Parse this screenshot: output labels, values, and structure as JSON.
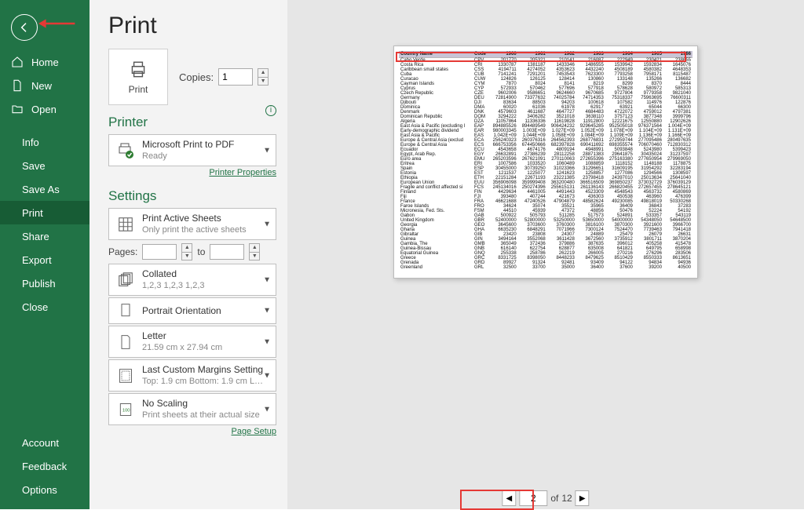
{
  "nav": {
    "home": "Home",
    "new": "New",
    "open": "Open",
    "info": "Info",
    "save": "Save",
    "save_as": "Save As",
    "print": "Print",
    "share": "Share",
    "export": "Export",
    "publish": "Publish",
    "close": "Close",
    "account": "Account",
    "feedback": "Feedback",
    "options": "Options"
  },
  "title": "Print",
  "print_button": "Print",
  "copies_label": "Copies:",
  "copies_value": "1",
  "printer_heading": "Printer",
  "printer": {
    "name": "Microsoft Print to PDF",
    "status": "Ready"
  },
  "printer_properties": "Printer Properties",
  "settings_heading": "Settings",
  "active_sheets": {
    "title": "Print Active Sheets",
    "sub": "Only print the active sheets"
  },
  "pages": {
    "label": "Pages:",
    "to": "to"
  },
  "collated": {
    "title": "Collated",
    "sub": "1,2,3    1,2,3    1,2,3"
  },
  "orientation": "Portrait Orientation",
  "paper": {
    "title": "Letter",
    "sub": "21.59 cm x 27.94 cm"
  },
  "margins": {
    "title": "Last Custom Margins Setting",
    "sub": "Top: 1.9 cm Bottom: 1.9 cm L…"
  },
  "scaling": {
    "title": "No Scaling",
    "sub": "Print sheets at their actual size"
  },
  "page_setup": "Page Setup",
  "pager": {
    "current": "2",
    "of_label": "of",
    "total": "12"
  },
  "preview": {
    "headers": [
      "Country Name",
      "Code",
      "1960",
      "1961",
      "1962",
      "1963",
      "1964",
      "1965",
      "1966"
    ],
    "rows": [
      [
        "Cabo Verde",
        "CPV",
        "201770",
        "205321",
        "210141",
        "216087",
        "222949",
        "230421",
        "238655"
      ],
      [
        "Costa Rica",
        "CRI",
        "1330787",
        "1381187",
        "1433346",
        "1486555",
        "1539942",
        "1592834",
        "1645076"
      ],
      [
        "Caribbean small states",
        "CSS",
        "4194711",
        "4274052",
        "4353623",
        "4432240",
        "4508189",
        "4580382",
        "4648353"
      ],
      [
        "Cuba",
        "CUB",
        "7141241",
        "7291201",
        "7453543",
        "7623300",
        "7793258",
        "7958171",
        "8115487"
      ],
      [
        "Curacao",
        "CUW",
        "124826",
        "126125",
        "128414",
        "130860",
        "133148",
        "135266",
        "136682"
      ],
      [
        "Cayman Islands",
        "CYM",
        "7870",
        "8024",
        "8141",
        "8219",
        "8299",
        "8370",
        "8444"
      ],
      [
        "Cyprus",
        "CYP",
        "572933",
        "570462",
        "577696",
        "577918",
        "578628",
        "580972",
        "585313"
      ],
      [
        "Czech Republic",
        "CZE",
        "9602006",
        "9586651",
        "9624660",
        "9670685",
        "9727804",
        "9779358",
        "9821040"
      ],
      [
        "Germany",
        "DEU",
        "72814900",
        "73377632",
        "74025784",
        "74714353",
        "75318337",
        "75963695",
        "76600311"
      ],
      [
        "Djibouti",
        "DJI",
        "83634",
        "88503",
        "94203",
        "100618",
        "107582",
        "114976",
        "122876"
      ],
      [
        "Dominica",
        "DMA",
        "60020",
        "61036",
        "61978",
        "62917",
        "63921",
        "65044",
        "66300"
      ],
      [
        "Denmark",
        "DNK",
        "4579603",
        "4611687",
        "4647727",
        "4684483",
        "4722072",
        "4759012",
        "4797381"
      ],
      [
        "Dominican Republic",
        "DOM",
        "3294222",
        "3406282",
        "3521018",
        "3638110",
        "3757123",
        "3877348",
        "3999796"
      ],
      [
        "Algeria",
        "DZA",
        "11057864",
        "11336336",
        "11619828",
        "11912800",
        "12221675",
        "12550880",
        "12902626"
      ],
      [
        "East Asia & Pacific (excluding I",
        "EAP",
        "894885526",
        "894489549",
        "906424232",
        "929645285",
        "952505018",
        "976371564",
        "1.004E+09"
      ],
      [
        "Early-demographic dividend",
        "EAR",
        "980003345",
        "1.003E+09",
        "1.027E+09",
        "1.052E+09",
        "1.078E+09",
        "1.104E+09",
        "1.131E+09"
      ],
      [
        "East Asia & Pacific",
        "EAS",
        "1.042E+09",
        "1.044E+09",
        "1.058E+09",
        "1.084E+09",
        "1.109E+09",
        "1.136E+09",
        "1.166E+09"
      ],
      [
        "Europe & Central Asia (exclud",
        "ECA",
        "256240323",
        "260376316",
        "264562393",
        "268776831",
        "272959744",
        "277095486",
        "280497635"
      ],
      [
        "Europe & Central Asia",
        "ECS",
        "666753356",
        "674450666",
        "682397828",
        "690411692",
        "698355574",
        "706070460",
        "712830312"
      ],
      [
        "Ecuador",
        "ECU",
        "4543658",
        "4674176",
        "4809194",
        "4948991",
        "5093848",
        "5243980",
        "5399423"
      ],
      [
        "Egypt, Arab Rep.",
        "EGY",
        "26632891",
        "27386239",
        "28112258",
        "28871383",
        "29641875",
        "30435024",
        "31237597"
      ],
      [
        "Euro area",
        "EMU",
        "265203596",
        "267621091",
        "270110063",
        "272655396",
        "275163380",
        "277650954",
        "279969050"
      ],
      [
        "Eritrea",
        "ERI",
        "1007586",
        "1033520",
        "1060489",
        "1088859",
        "1118152",
        "1148188",
        "1178875"
      ],
      [
        "Spain",
        "ESP",
        "30455000",
        "30739250",
        "31023366",
        "31296651",
        "31609195",
        "31954292",
        "32283194"
      ],
      [
        "Estonia",
        "EST",
        "1211537",
        "1225077",
        "1241623",
        "1258857",
        "1277086",
        "1294566",
        "1308597"
      ],
      [
        "Ethiopia",
        "ETH",
        "22151284",
        "22671193",
        "23221385",
        "23798418",
        "24397010",
        "25013634",
        "25641040"
      ],
      [
        "European Union",
        "EUU",
        "356906098",
        "359999408",
        "363200480",
        "366516509",
        "369850237",
        "373032729",
        "376039129"
      ],
      [
        "Fragile and conflict affected si",
        "FCS",
        "245134016",
        "250274396",
        "255615131",
        "261136143",
        "266820455",
        "272657455",
        "278645121"
      ],
      [
        "Finland",
        "FIN",
        "4429634",
        "4461005",
        "4491443",
        "4523309",
        "4548543",
        "4563732",
        "4580869"
      ],
      [
        "Fiji",
        "FJI",
        "393480",
        "407244",
        "421673",
        "436303",
        "450538",
        "463960",
        "476399"
      ],
      [
        "France",
        "FRA",
        "46621688",
        "47240526",
        "47904879",
        "48582624",
        "49230085",
        "49818019",
        "50330268"
      ],
      [
        "Faroe Islands",
        "FRO",
        "34624",
        "35074",
        "35521",
        "35965",
        "36409",
        "36843",
        "37283"
      ],
      [
        "Micronesia, Fed. Sts.",
        "FSM",
        "44510",
        "45939",
        "47372",
        "48856",
        "50476",
        "52224",
        "54192"
      ],
      [
        "Gabon",
        "GAB",
        "500922",
        "505793",
        "511285",
        "517573",
        "524891",
        "533357",
        "543119"
      ],
      [
        "United Kingdom",
        "GBR",
        "52400000",
        "52800000",
        "53250000",
        "53650000",
        "54000000",
        "54348050",
        "54648500"
      ],
      [
        "Georgia",
        "GEO",
        "3645600",
        "3703600",
        "3760300",
        "3816100",
        "3870300",
        "3921600",
        "3966700"
      ],
      [
        "Ghana",
        "GHA",
        "6635230",
        "6848291",
        "7071966",
        "7300124",
        "7524470",
        "7739463",
        "7941418"
      ],
      [
        "Gibraltar",
        "GIB",
        "23420",
        "23808",
        "24307",
        "24889",
        "25479",
        "26079",
        "26631"
      ],
      [
        "Guinea",
        "GIN",
        "3494164",
        "3552068",
        "3611428",
        "3672560",
        "3735912",
        "3801711",
        "3870204"
      ],
      [
        "Gambia, The",
        "GMB",
        "365049",
        "372436",
        "379886",
        "387635",
        "396012",
        "405258",
        "415478"
      ],
      [
        "Guinea-Bissau",
        "GNB",
        "616140",
        "622754",
        "628877",
        "635008",
        "641821",
        "649795",
        "658998"
      ],
      [
        "Equatorial Guinea",
        "GNQ",
        "255338",
        "258786",
        "262219",
        "266005",
        "270216",
        "276296",
        "283506"
      ],
      [
        "Greece",
        "GRC",
        "8331725",
        "8398050",
        "8448233",
        "8479625",
        "8510429",
        "8550333",
        "8613651"
      ],
      [
        "Grenada",
        "GRD",
        "89927",
        "91324",
        "92481",
        "93409",
        "94122",
        "94834",
        "94936"
      ],
      [
        "Greenland",
        "GRL",
        "32500",
        "33700",
        "35000",
        "36400",
        "37600",
        "39200",
        "40500"
      ]
    ]
  }
}
